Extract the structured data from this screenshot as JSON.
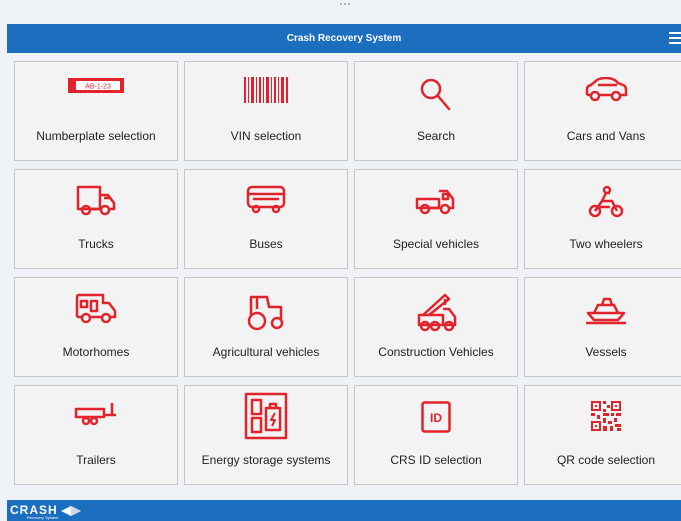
{
  "header": {
    "title": "Crash Recovery System"
  },
  "tiles": [
    {
      "label": "Numberplate selection",
      "icon_text": "AB-1-23"
    },
    {
      "label": "VIN selection"
    },
    {
      "label": "Search"
    },
    {
      "label": "Cars and Vans"
    },
    {
      "label": "Trucks"
    },
    {
      "label": "Buses"
    },
    {
      "label": "Special vehicles"
    },
    {
      "label": "Two wheelers"
    },
    {
      "label": "Motorhomes"
    },
    {
      "label": "Agricultural vehicles"
    },
    {
      "label": "Construction Vehicles"
    },
    {
      "label": "Vessels"
    },
    {
      "label": "Trailers"
    },
    {
      "label": "Energy storage systems"
    },
    {
      "label": "CRS ID selection",
      "icon_text": "ID"
    },
    {
      "label": "QR code selection"
    }
  ],
  "footer": {
    "logo_text": "CRASH",
    "logo_subtext": "Recovery System"
  },
  "colors": {
    "header": "#1c6fbe",
    "icon": "#e3232b",
    "tile": "#f3f3f3",
    "page": "#eef1f5"
  }
}
